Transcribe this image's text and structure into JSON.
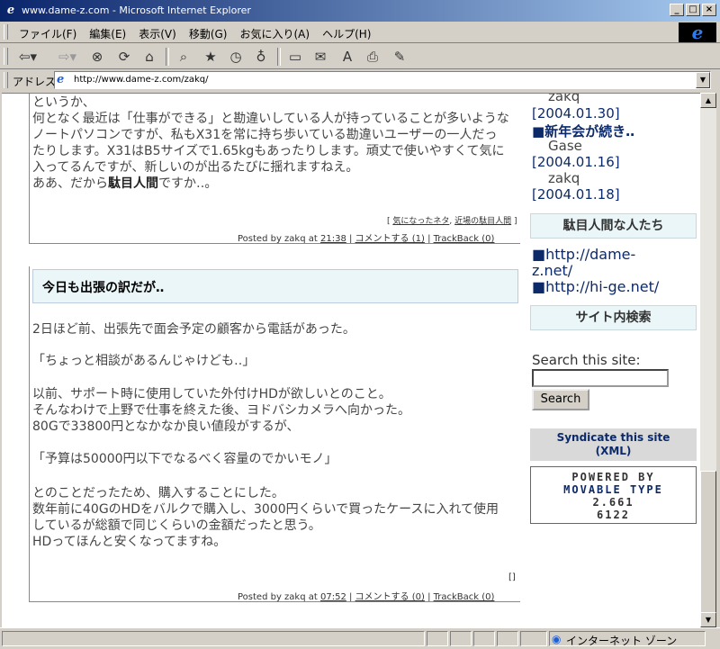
{
  "window": {
    "title": "www.dame-z.com - Microsoft Internet Explorer"
  },
  "menu": [
    "ファイル(F)",
    "編集(E)",
    "表示(V)",
    "移動(G)",
    "お気に入り(A)",
    "ヘルプ(H)"
  ],
  "address": {
    "label": "アドレス",
    "url": "http://www.dame-z.com/zakq/"
  },
  "post1": {
    "lines": [
      "というか、",
      "何となく最近は「仕事ができる」と勘違いしている人が持っていることが多いような",
      "ノートパソコンですが、私もX31を常に持ち歩いている勘違いユーザーの一人だっ",
      "たりします。X31はB5サイズで1.65kgもあったりします。頑丈で使いやすくて気に",
      "入ってるんですが、新しいのが出るたびに揺れますねえ。"
    ],
    "last_line_prefix": "ああ、だから",
    "last_line_bold": "駄目人間",
    "last_line_suffix": "ですか‥。",
    "categories": [
      "気になったネタ",
      "近場の駄目人間"
    ],
    "posted_by": "Posted by zakq at",
    "time": "21:38",
    "comments": "コメントする (1)",
    "trackback": "TrackBack (0)"
  },
  "post2": {
    "title": "今日も出張の訳だが‥",
    "lines": [
      "2日ほど前、出張先で面会予定の顧客から電話があった。",
      "",
      "「ちょっと相談があるんじゃけども‥」",
      "",
      "以前、サポート時に使用していた外付けHDが欲しいとのこと。",
      "そんなわけで上野で仕事を終えた後、ヨドバシカメラへ向かった。",
      "80Gで33800円となかなか良い値段がするが、",
      "",
      "「予算は50000円以下でなるべく容量のでかいモノ」",
      "",
      "とのことだったため、購入することにした。",
      "数年前に40GのHDをバルクで購入し、3000円くらいで買ったケースに入れて使用",
      "しているが総額で同じくらいの金額だったと思う。",
      "HDってほんと安くなってますね。"
    ],
    "categories": "[]",
    "posted_by": "Posted by zakq at",
    "time": "07:52",
    "comments": "コメントする (0)",
    "trackback": "TrackBack (0)"
  },
  "sidebar": {
    "recent_comments": [
      {
        "text": "zakq",
        "style": "name"
      },
      {
        "text": "[2004.01.30]",
        "style": "date"
      },
      {
        "text": "■新年会が続き‥",
        "style": "title"
      },
      {
        "text": "Gase",
        "style": "name"
      },
      {
        "text": "[2004.01.16]",
        "style": "date"
      },
      {
        "text": "zakq",
        "style": "name"
      },
      {
        "text": "[2004.01.18]",
        "style": "date"
      }
    ],
    "people_header": "駄目人間な人たち",
    "links": [
      "■http://dame-",
      "z.net/",
      "■http://hi-ge.net/"
    ],
    "search_header": "サイト内検索",
    "search_label": "Search this site:",
    "search_button": "Search",
    "syndicate_line1": "Syndicate this site",
    "syndicate_line2": "(XML)",
    "powered": [
      "POWERED BY",
      "MOVABLE TYPE",
      "2.661",
      "6122"
    ]
  },
  "status": {
    "zone": "インターネット ゾーン"
  }
}
